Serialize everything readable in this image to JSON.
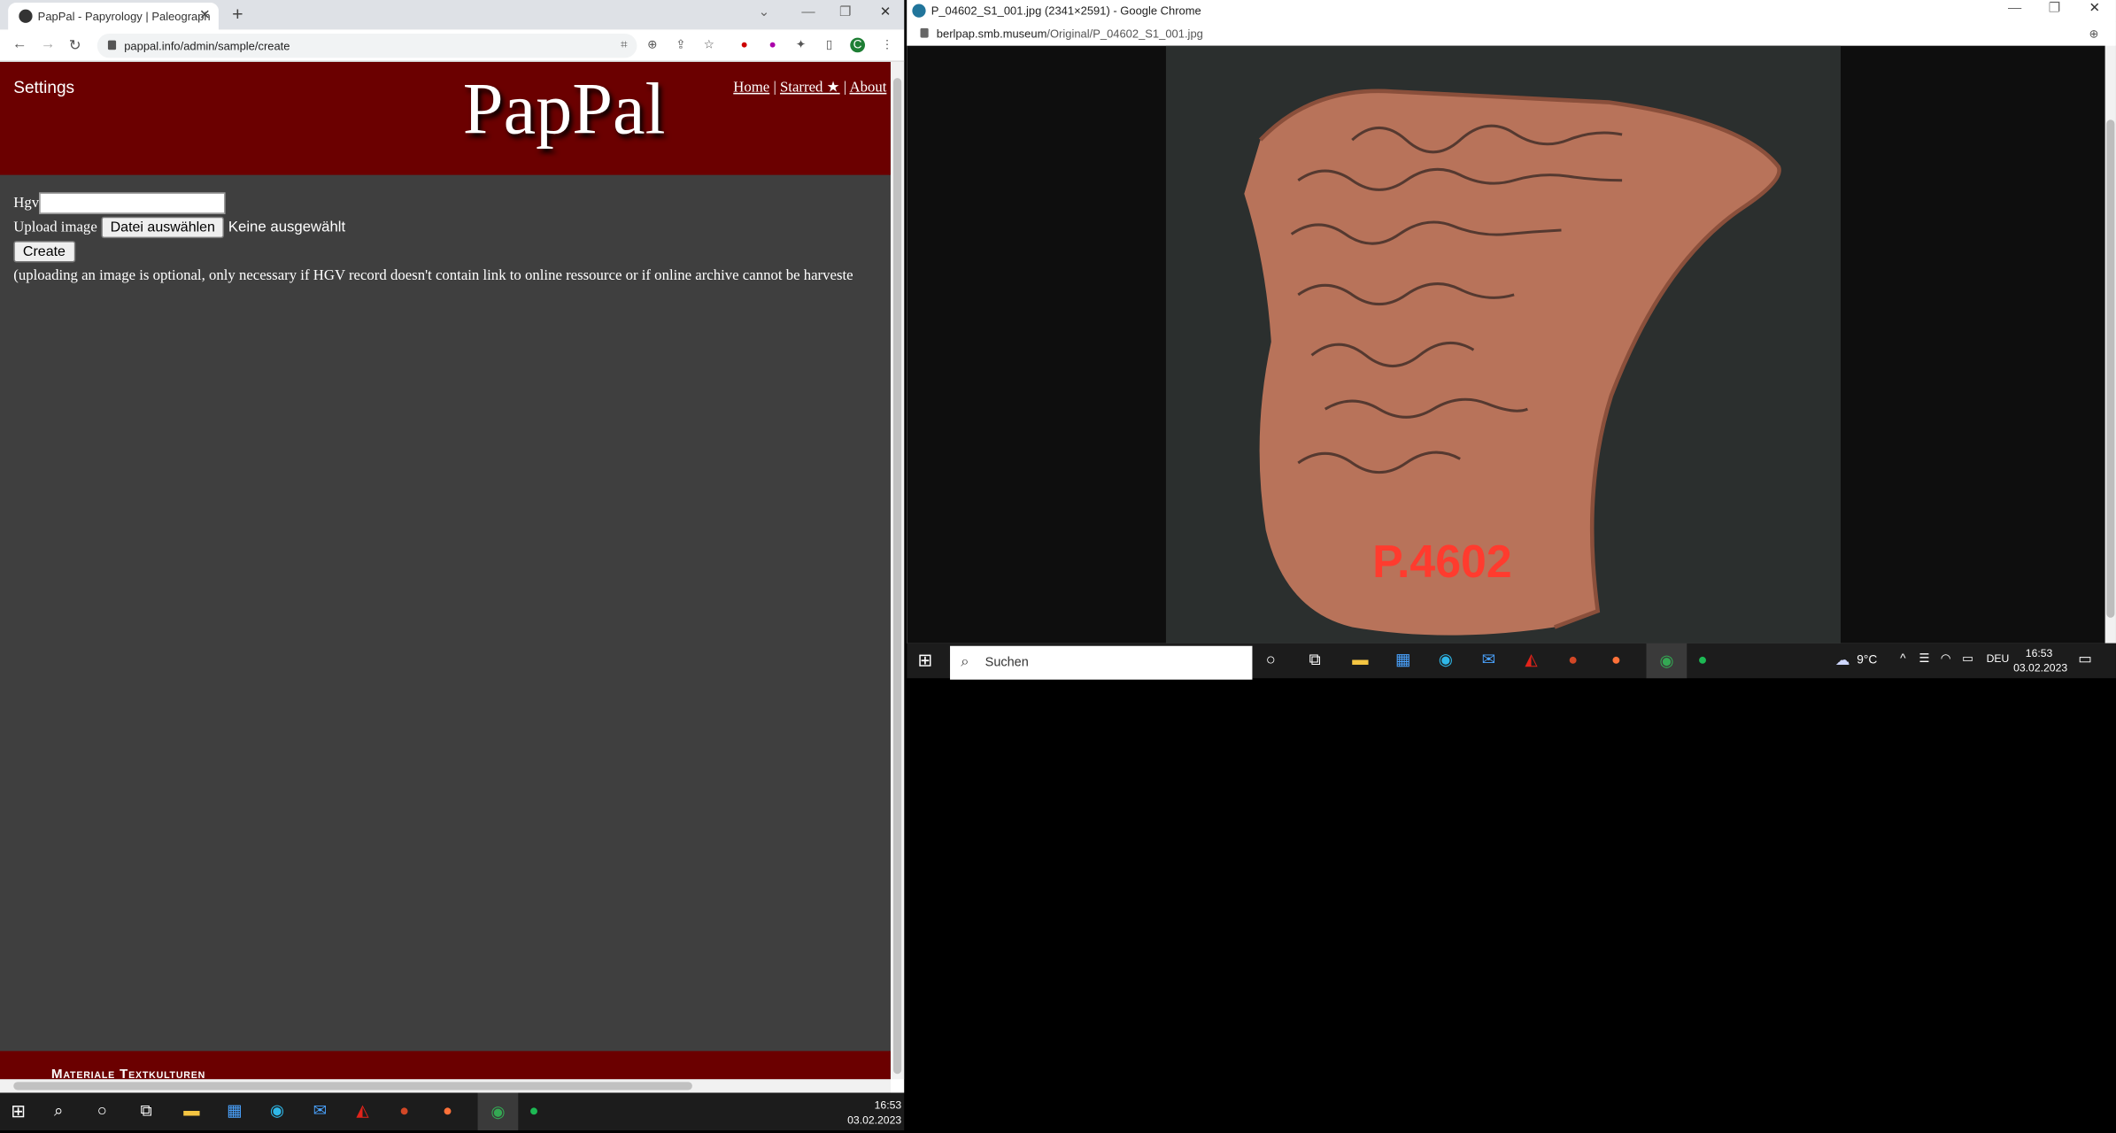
{
  "left_window": {
    "tab_title": "PapPal - Papyrology | Paleograph",
    "url": "pappal.info/admin/sample/create",
    "profile_initial": "C"
  },
  "page": {
    "settings_label": "Settings",
    "logo": "PapPal",
    "nav": {
      "home": "Home",
      "starred": "Starred ★",
      "about": "About",
      "sep": "|"
    },
    "form": {
      "hgv_label": "Hgv",
      "hgv_value": "",
      "upload_label": "Upload image",
      "file_button": "Datei auswählen",
      "file_status": "Keine ausgewählt",
      "create_button": "Create",
      "note": "(uploading an image is optional, only necessary if HGV record doesn't contain link to online ressource or if online archive cannot be harveste"
    },
    "footer_text": "Materiale Textkulturen"
  },
  "right_window": {
    "title": "P_04602_S1_001.jpg (2341×2591) - Google Chrome",
    "url_host": "berlpap.smb.museum",
    "url_path": "/Original/P_04602_S1_001.jpg",
    "image_label": "P.4602"
  },
  "taskbar_right": {
    "search_placeholder": "Suchen",
    "weather": "9°C",
    "language": "DEU",
    "time": "16:53",
    "date": "03.02.2023"
  },
  "taskbar_bottom": {
    "time": "16:53",
    "date": "03.02.2023"
  },
  "colors": {
    "header": "#6b0000",
    "page_bg": "#3f3f3f",
    "taskbar": "#1c1c1c"
  }
}
